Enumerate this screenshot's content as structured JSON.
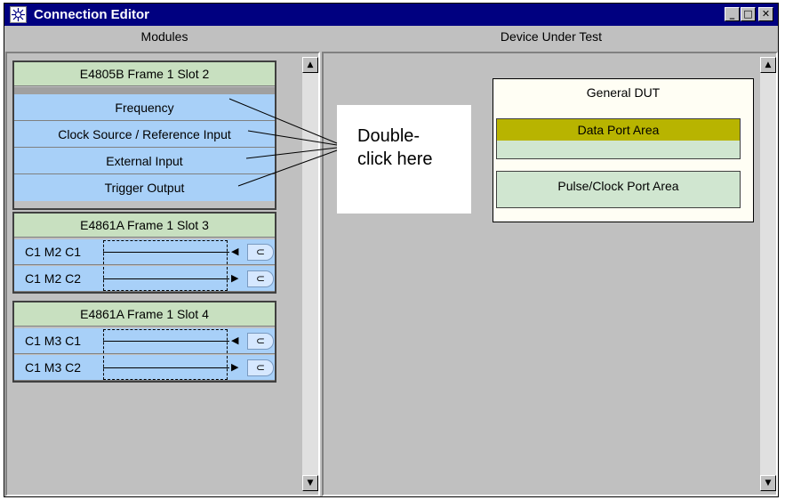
{
  "window": {
    "title": "Connection Editor",
    "buttons": {
      "minimize": "_",
      "maximize": "□",
      "close": "✕"
    }
  },
  "columns": {
    "modules": "Modules",
    "dut": "Device Under Test"
  },
  "modules": [
    {
      "header": "E4805B   Frame 1   Slot 2",
      "rows": [
        "Frequency",
        "Clock Source / Reference Input",
        "External Input",
        "Trigger Output"
      ]
    },
    {
      "header": "E4861A   Frame 1   Slot 3",
      "channels": [
        {
          "label": "C1 M2 C1",
          "direction": "in"
        },
        {
          "label": "C1 M2 C2",
          "direction": "out"
        }
      ]
    },
    {
      "header": "E4861A   Frame 1   Slot 4",
      "channels": [
        {
          "label": "C1 M3 C1",
          "direction": "in"
        },
        {
          "label": "C1 M3 C2",
          "direction": "out"
        }
      ]
    }
  ],
  "callout": {
    "line1": "Double-",
    "line2": "click here"
  },
  "dut": {
    "title": "General DUT",
    "data_area": "Data Port Area",
    "pulse_area": "Pulse/Clock Port Area"
  },
  "colors": {
    "title_bar": "#000080",
    "module_header": "#c8e0c0",
    "module_row": "#a8d0f8",
    "data_area": "#b8b400",
    "area_bg": "#d0e6d0"
  },
  "icons": {
    "scroll_up": "▲",
    "scroll_down": "▼",
    "arrow_in": "◀",
    "arrow_out": "▶",
    "connector": "⊂"
  }
}
